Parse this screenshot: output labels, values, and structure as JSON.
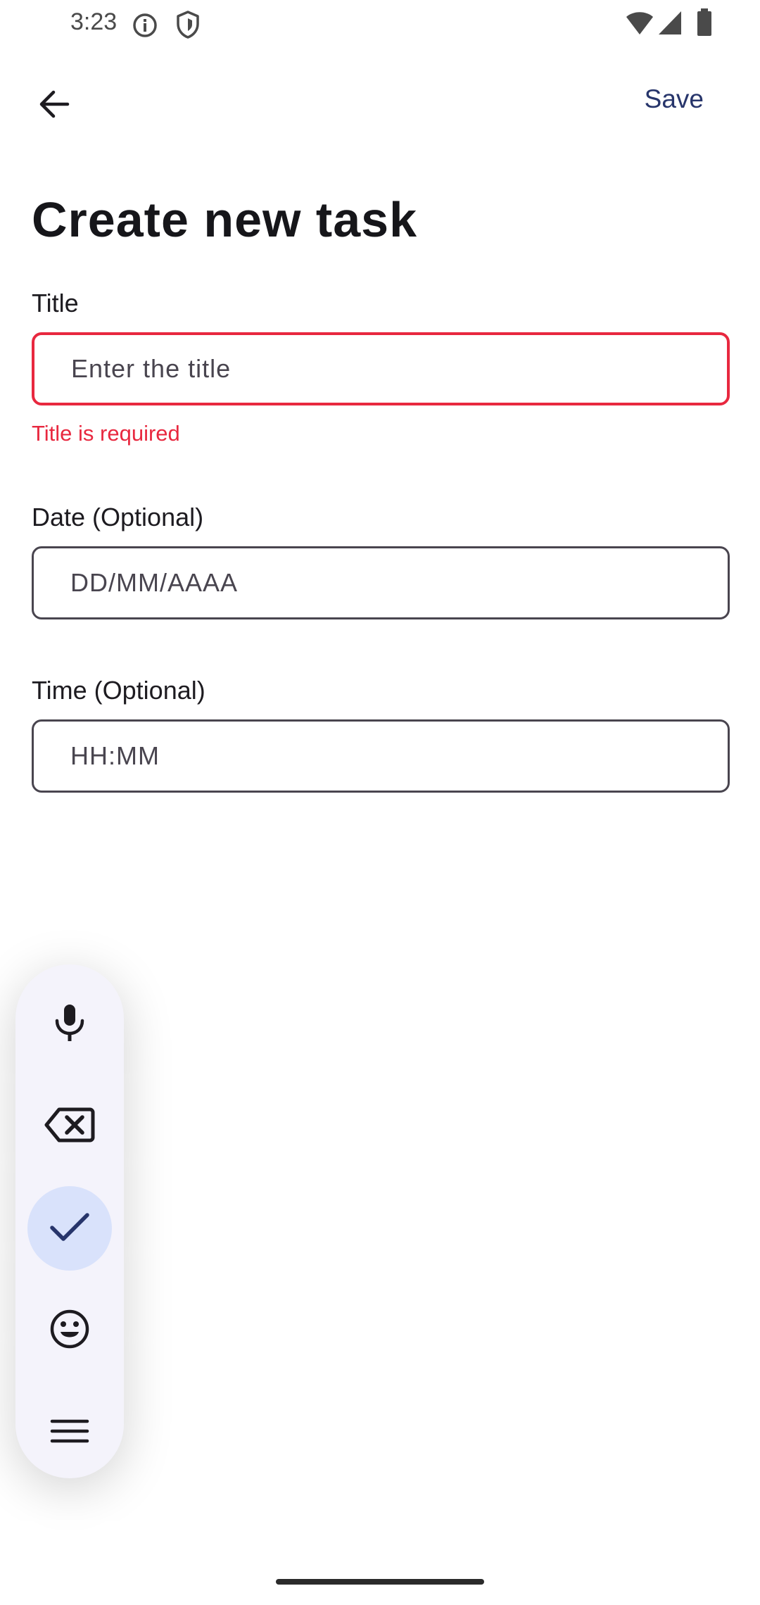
{
  "status_bar": {
    "time": "3:23",
    "icons": [
      "info-icon",
      "shield-icon",
      "wifi-icon",
      "signal-icon",
      "battery-icon"
    ]
  },
  "top_bar": {
    "back_icon": "back-arrow-icon",
    "save_label": "Save"
  },
  "page_title": "Create new task",
  "form": {
    "title_field": {
      "label": "Title",
      "placeholder": "Enter the title",
      "error": "Title is required"
    },
    "date_field": {
      "label": "Date (Optional)",
      "placeholder": "DD/MM/AAAA"
    },
    "time_field": {
      "label": "Time (Optional)",
      "placeholder": "HH:MM"
    }
  },
  "floating_toolbar": {
    "items": [
      "microphone-icon",
      "backspace-icon",
      "checkmark-icon",
      "emoji-icon",
      "menu-icon"
    ],
    "active_item": "checkmark-icon"
  },
  "colors": {
    "error": "#e8283f",
    "accent": "#27356b",
    "toolbar_background": "#f4f3fb",
    "active_tool": "#d9e2fb",
    "field_border": "#49454f"
  }
}
